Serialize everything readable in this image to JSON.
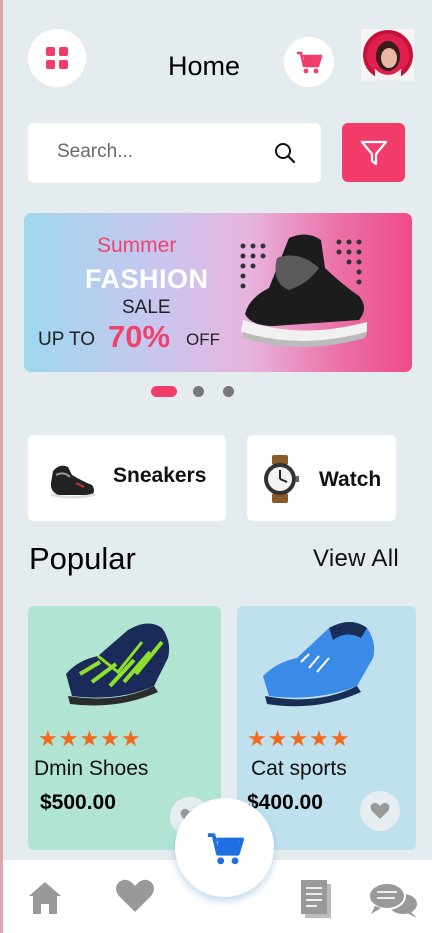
{
  "header": {
    "title": "Home",
    "menu_icon": "grid-menu-icon",
    "cart_icon": "cart-icon",
    "avatar": "user-avatar"
  },
  "search": {
    "placeholder": "Search...",
    "filter_icon": "filter-icon"
  },
  "banner": {
    "line1": "Summer",
    "line2": "FASHION",
    "line3": "SALE",
    "prefix": "UP TO",
    "percent": "70%",
    "suffix": "OFF",
    "pager": {
      "count": 3,
      "active_index": 0
    }
  },
  "categories": [
    {
      "label": "Sneakers",
      "icon": "sneaker-icon"
    },
    {
      "label": "Watch",
      "icon": "watch-icon"
    }
  ],
  "popular": {
    "heading": "Popular",
    "view_all": "View All",
    "products": [
      {
        "stars": "★★★★★",
        "name": "Dmin Shoes",
        "price": "$500.00",
        "bg": "#b1e4d3"
      },
      {
        "stars": "★★★★★",
        "name": "Cat sports",
        "price": "$400.00",
        "bg": "#bfe0ed"
      }
    ]
  },
  "bottom_nav": [
    "home-icon",
    "heart-icon",
    "cart-icon",
    "document-icon",
    "chat-icon"
  ],
  "colors": {
    "accent": "#f23d6a",
    "star": "#f26a1e",
    "fab_cart": "#1f6fe0",
    "background": "#e4ecef"
  }
}
